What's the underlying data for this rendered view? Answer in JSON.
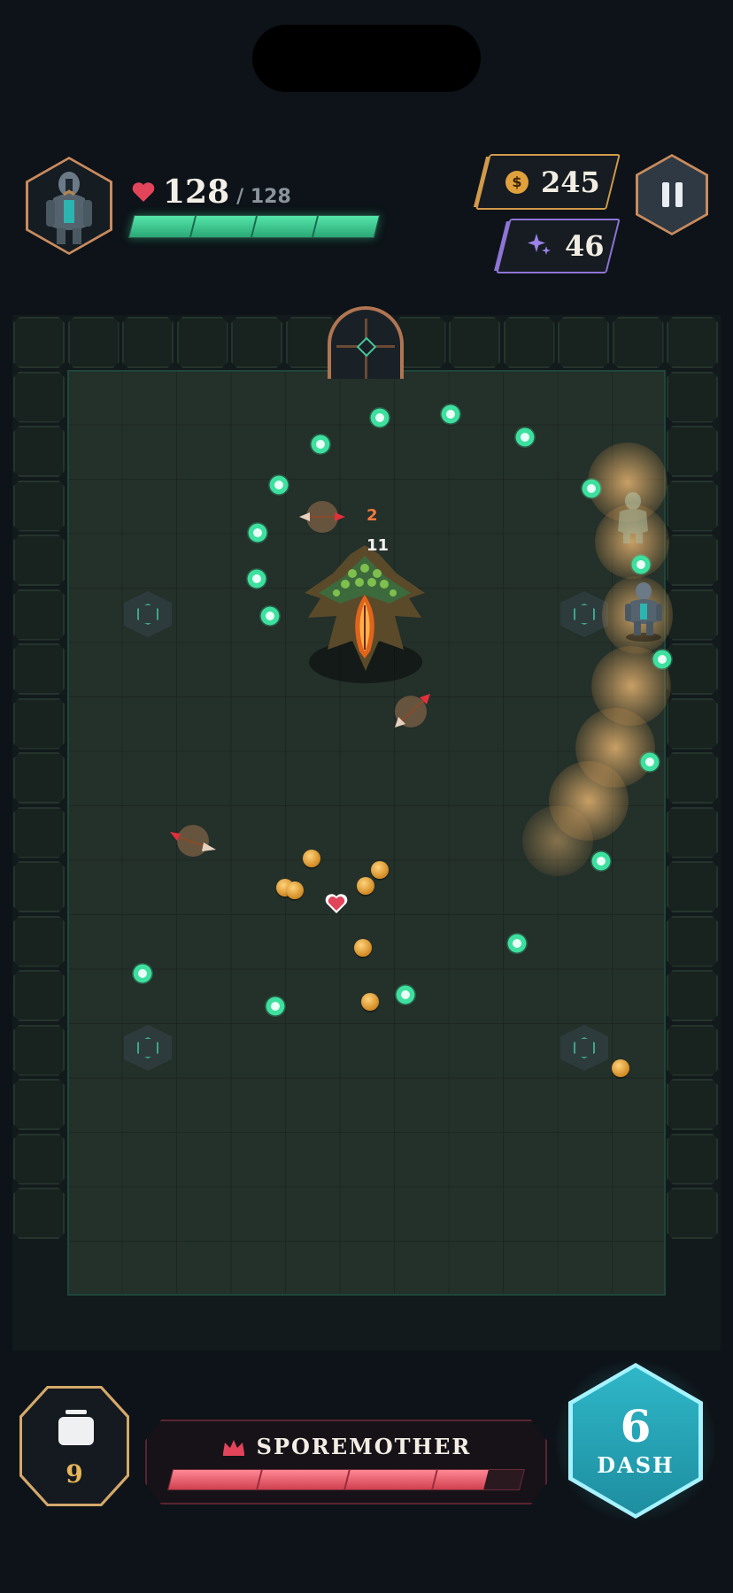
{
  "player": {
    "hp_current": "128",
    "hp_max": "/ 128",
    "hp_fraction": 1.0
  },
  "currency": {
    "gold": "245",
    "gold_symbol": "$",
    "essence": "46"
  },
  "combat": {
    "damage_numbers": [
      "2",
      "11"
    ]
  },
  "boss": {
    "name": "SPOREMOTHER",
    "hp_fraction": 0.9
  },
  "actions": {
    "bombs": "9",
    "dash_label": "DASH",
    "dash_icon": "6"
  },
  "colors": {
    "hp_bar": "#3dd69a",
    "boss_bar": "#e04a5a",
    "gold_border": "#d19a4a",
    "essence_border": "#8f74d6",
    "dash": "#2fb7c8",
    "orb": "#3de09f"
  },
  "icons": {
    "portrait": "armored-knight-icon",
    "hp": "heart-icon",
    "gold": "coin-icon",
    "essence": "sparkle-icon",
    "pause": "pause-icon",
    "boss": "crown-icon",
    "bomb": "jar-icon",
    "dash": "swirl-icon"
  }
}
